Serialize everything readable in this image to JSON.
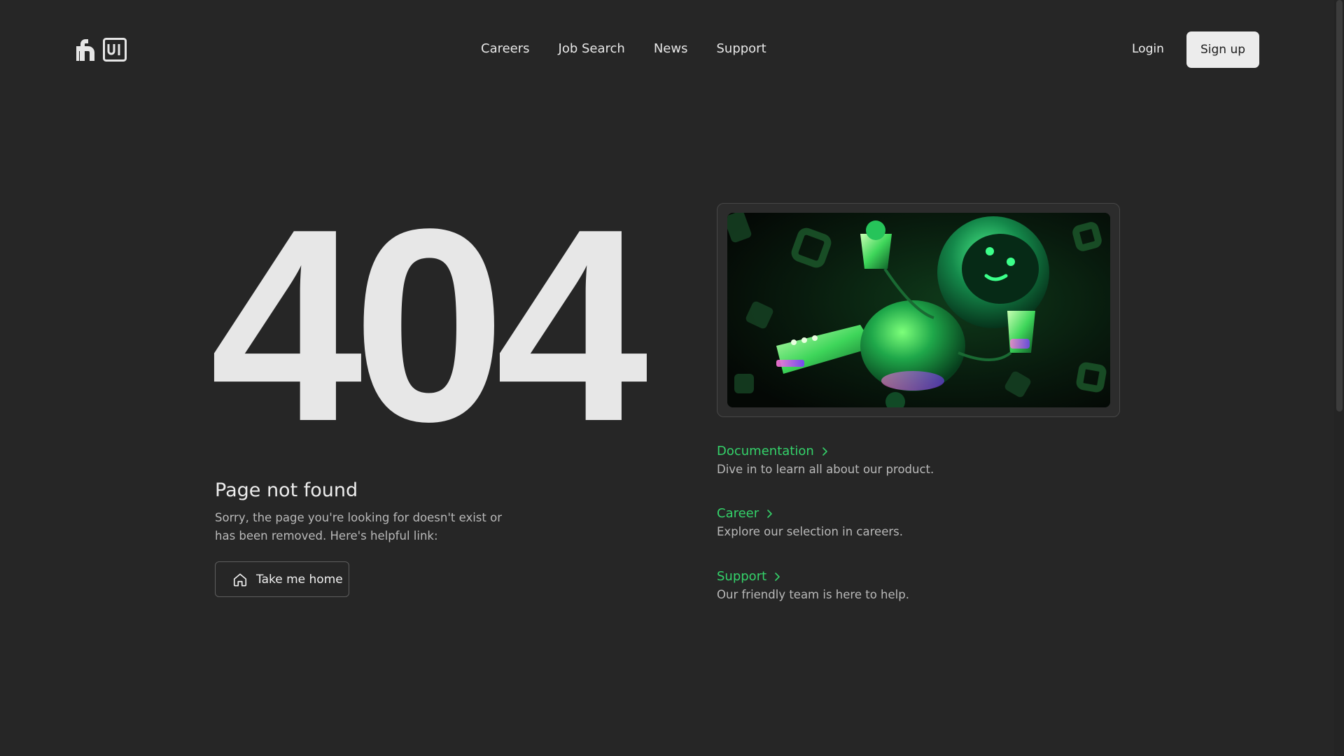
{
  "header": {
    "nav": [
      "Careers",
      "Job Search",
      "News",
      "Support"
    ],
    "login_label": "Login",
    "signup_label": "Sign up"
  },
  "error": {
    "code": "404",
    "title": "Page not found",
    "description": "Sorry, the page you're looking for doesn't exist or has been removed. Here's helpful link:",
    "home_button": "Take me home"
  },
  "links": [
    {
      "title": "Documentation",
      "description": "Dive in to learn all about our product."
    },
    {
      "title": "Career",
      "description": "Explore our selection in careers."
    },
    {
      "title": "Support",
      "description": "Our friendly team is here to help."
    }
  ],
  "colors": {
    "background": "#262626",
    "accent": "#34d26a",
    "text": "#e6e6e6",
    "muted": "#b9b9b9"
  },
  "icons": {
    "logo": "logo-icon",
    "home": "home-icon",
    "chevron": "chevron-right-icon"
  }
}
